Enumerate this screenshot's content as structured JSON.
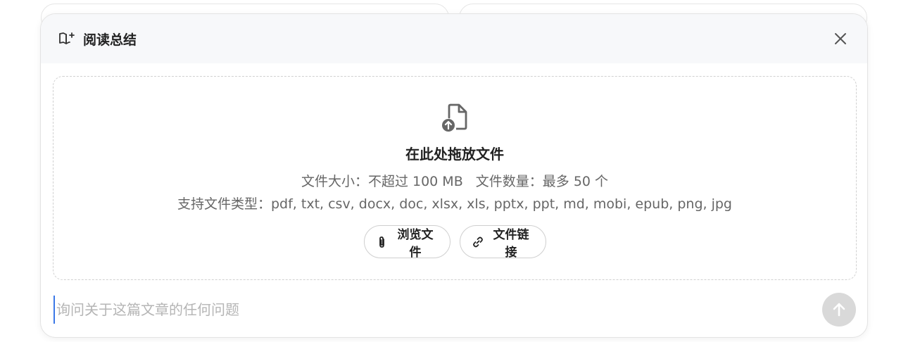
{
  "panel": {
    "title": "阅读总结",
    "header_icon": "book-sparkle-icon",
    "close_icon": "close-icon"
  },
  "dropzone": {
    "icon": "file-upload-icon",
    "title": "在此处拖放文件",
    "size_limit": "文件大小：不超过 100 MB",
    "count_limit": "文件数量：最多 50 个",
    "supported_types": "支持文件类型：pdf, txt, csv, docx, doc, xlsx, xls, pptx, ppt, md, mobi, epub, png, jpg"
  },
  "buttons": {
    "browse_label": "浏览文件",
    "browse_icon": "paperclip-icon",
    "link_label": "文件链接",
    "link_icon": "link-icon"
  },
  "input": {
    "placeholder": "询问关于这篇文章的任何问题",
    "value": ""
  },
  "send": {
    "icon": "arrow-up-icon",
    "color": "#d9d9d9"
  }
}
